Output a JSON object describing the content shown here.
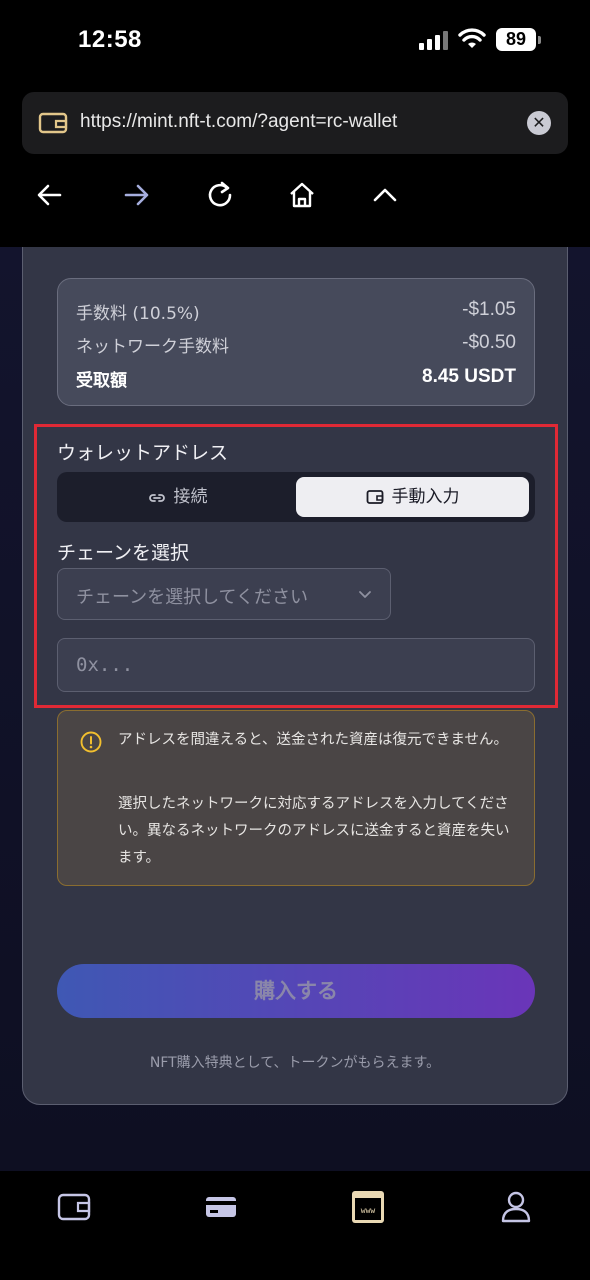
{
  "status_bar": {
    "time": "12:58",
    "battery": "89"
  },
  "browser": {
    "url": "https://mint.nft-t.com/?agent=rc-wallet"
  },
  "fees": {
    "rows": [
      {
        "label": "手数料 (10.5%)",
        "value": "-$1.05"
      },
      {
        "label": "ネットワーク手数料",
        "value": "-$0.50"
      }
    ],
    "total_label": "受取額",
    "total_value": "8.45 USDT"
  },
  "wallet": {
    "title": "ウォレットアドレス",
    "connect_label": "接続",
    "manual_label": "手動入力",
    "chain_title": "チェーンを選択",
    "chain_placeholder": "チェーンを選択してください",
    "address_placeholder": "0x..."
  },
  "warning": {
    "line1": "アドレスを間違えると、送金された資産は復元できません。",
    "line2": "選択したネットワークに対応するアドレスを入力してください。異なるネットワークのアドレスに送金すると資産を失います。"
  },
  "purchase": {
    "button": "購入する",
    "note": "NFT購入特典として、トークンがもらえます。"
  },
  "colors": {
    "accent_border": "#e02935",
    "button_gradient_start": "#3f58b4",
    "button_gradient_end": "#6a35b8",
    "tab_accent": "#ead9b4"
  },
  "icons": {
    "tabs": [
      "wallet-icon",
      "card-icon",
      "browser-icon",
      "profile-icon"
    ]
  }
}
